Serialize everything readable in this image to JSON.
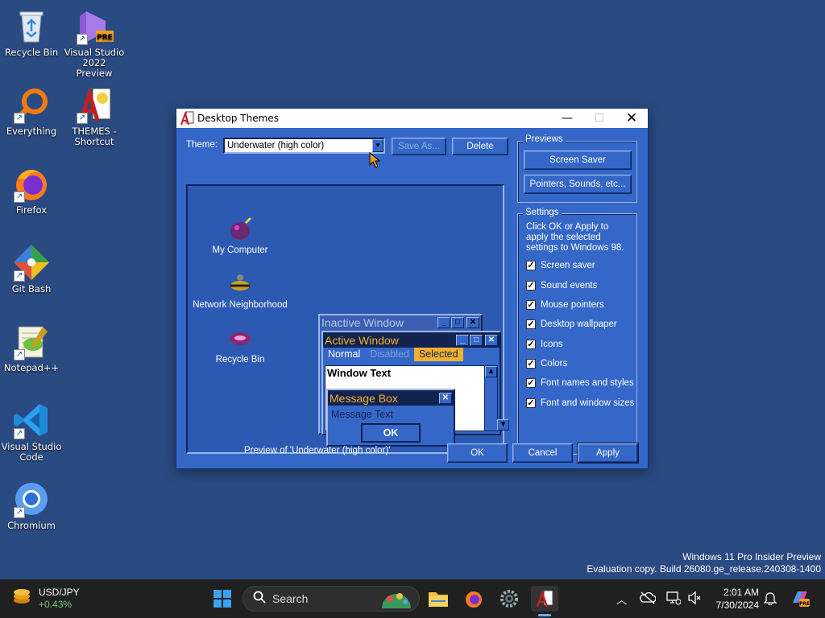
{
  "desktop": {
    "icons": [
      {
        "label": "Recycle Bin"
      },
      {
        "label": "Visual Studio 2022 Preview",
        "badge": "PRE"
      },
      {
        "label": "Everything"
      },
      {
        "label": "THEMES - Shortcut"
      },
      {
        "label": "Firefox"
      },
      {
        "label": "Git Bash"
      },
      {
        "label": "Notepad++"
      },
      {
        "label": "Visual Studio Code"
      },
      {
        "label": "Chromium"
      }
    ],
    "watermark": {
      "line1": "Windows 11 Pro Insider Preview",
      "line2": "Evaluation copy. Build 26080.ge_release.240308-1400"
    }
  },
  "dialog": {
    "title": "Desktop Themes",
    "theme_label": "Theme:",
    "theme_value": "Underwater (high color)",
    "save_as_label": "Save As...",
    "delete_label": "Delete",
    "previews_group": "Previews",
    "screen_saver_btn": "Screen Saver",
    "pointers_btn": "Pointers, Sounds, etc...",
    "settings_group": "Settings",
    "settings_desc": "Click OK or Apply to apply the selected settings to Windows 98.",
    "checkboxes": [
      {
        "label": "Screen saver",
        "checked": true
      },
      {
        "label": "Sound events",
        "checked": true
      },
      {
        "label": "Mouse pointers",
        "checked": true
      },
      {
        "label": "Desktop wallpaper",
        "checked": true
      },
      {
        "label": "Icons",
        "checked": true
      },
      {
        "label": "Colors",
        "checked": true
      },
      {
        "label": "Font names and styles",
        "checked": true
      },
      {
        "label": "Font and window sizes",
        "checked": true
      }
    ],
    "preview_caption": "Preview of 'Underwater (high color)'",
    "ok_label": "OK",
    "cancel_label": "Cancel",
    "apply_label": "Apply",
    "preview": {
      "icons": [
        "My Computer",
        "Network Neighborhood",
        "Recycle Bin"
      ],
      "inactive_title": "Inactive Window",
      "active_title": "Active Window",
      "menu_normal": "Normal",
      "menu_disabled": "Disabled",
      "menu_selected": "Selected",
      "window_text": "Window Text",
      "msgbox_title": "Message Box",
      "msgbox_text": "Message Text",
      "msgbox_ok": "OK"
    }
  },
  "taskbar": {
    "widget_title": "USD/JPY",
    "widget_value": "+0.43%",
    "search_placeholder": "Search",
    "time": "2:01 AM",
    "date": "7/30/2024"
  },
  "colors": {
    "desktop_bg": "#2a4a82",
    "dialog_bg": "#3467c8",
    "active_title_bg": "#13234f",
    "title_text_accent": "#f0b030"
  }
}
